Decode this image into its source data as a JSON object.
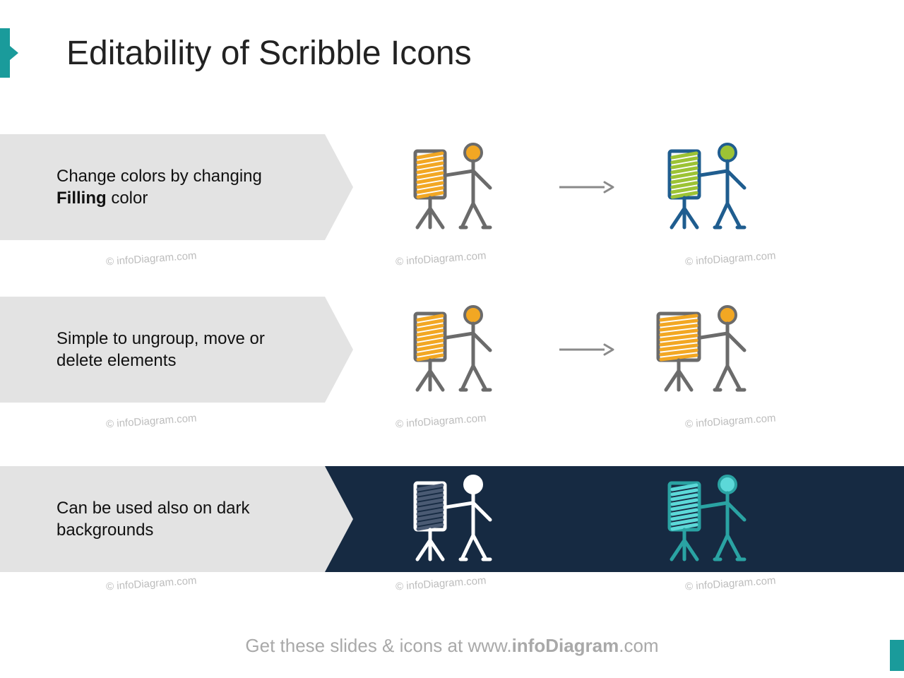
{
  "title": "Editability of Scribble Icons",
  "rows": [
    {
      "text_pre": "Change colors by changing ",
      "text_bold": "Filling",
      "text_post": " color",
      "dark": false,
      "iconA": {
        "stroke": "#6b6b6b",
        "fill": "#f2a723",
        "head": "#f2a723"
      },
      "iconB": {
        "stroke": "#1f5d8f",
        "fill": "#9cc335",
        "head": "#9cc335"
      },
      "arrow": true
    },
    {
      "text_pre": "Simple to ungroup, move or delete elements",
      "text_bold": "",
      "text_post": "",
      "dark": false,
      "iconA": {
        "stroke": "#6b6b6b",
        "fill": "#f2a723",
        "head": "#f2a723"
      },
      "iconB": {
        "stroke": "#6b6b6b",
        "fill": "#f2a723",
        "head": "#f2a723",
        "variant": "moved"
      },
      "arrow": true
    },
    {
      "text_pre": "Can be used also on dark backgrounds",
      "text_bold": "",
      "text_post": "",
      "dark": true,
      "iconA": {
        "stroke": "#ffffff",
        "fill": "#4a5a73",
        "head": "#ffffff"
      },
      "iconB": {
        "stroke": "#2aa3a3",
        "fill": "#5cd8d8",
        "head": "#5cd8d8"
      },
      "arrow": false
    }
  ],
  "watermark": "© infoDiagram.com",
  "footer_pre": "Get these slides & icons at www.",
  "footer_bold": "infoDiagram",
  "footer_post": ".com"
}
